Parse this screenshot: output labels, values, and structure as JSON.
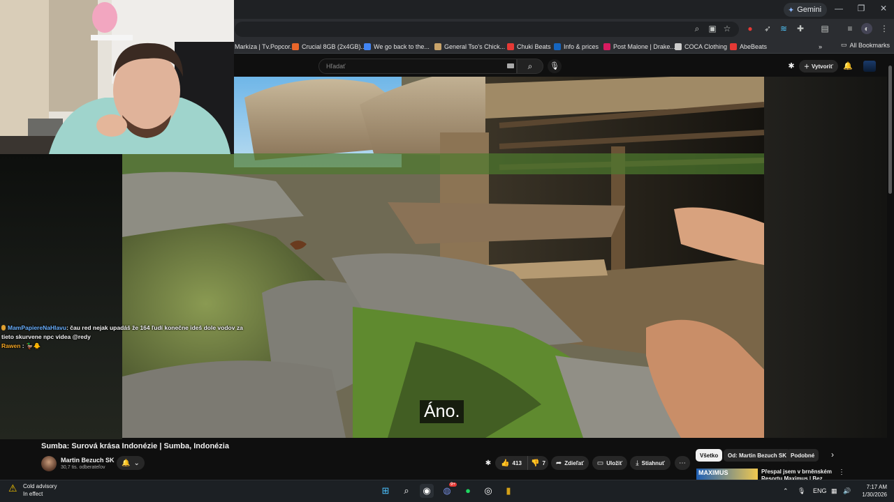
{
  "browser": {
    "gemini_label": "Gemini",
    "bookmarks": [
      {
        "label": "Markíza | Tv.Popcor...",
        "color": "#3c4fa0"
      },
      {
        "label": "Crucial 8GB (2x4GB)...",
        "color": "#e8662a"
      },
      {
        "label": "We go back to the...",
        "color": "#4285f4"
      },
      {
        "label": "General Tso's Chick...",
        "color": "#c9a46a"
      },
      {
        "label": "Chuki Beats",
        "color": "#e53935"
      },
      {
        "label": "Info & prices",
        "color": "#1565c0"
      },
      {
        "label": "Post Malone | Drake...",
        "color": "#d81b60"
      },
      {
        "label": "COCA Clothing",
        "color": "#cccccc"
      },
      {
        "label": "AbeBeats",
        "color": "#e53935"
      }
    ],
    "all_bookmarks_label": "All Bookmarks"
  },
  "youtube": {
    "search_placeholder": "Hľadať",
    "create_label": "Vytvoriť"
  },
  "video": {
    "caption": "Áno.",
    "title": "Sumba: Surová krása Indonézie | Sumba, Indonézia",
    "channel_name": "Martin Bezuch SK",
    "subscribers": "30,7 tis. odberateľov",
    "likes": "413",
    "dislikes": "7",
    "share_label": "Zdieľať",
    "save_label": "Uložiť",
    "download_label": "Stiahnuť"
  },
  "chips": [
    {
      "label": "Všetko",
      "active": true
    },
    {
      "label": "Od: Martin Bezuch SK",
      "active": false
    },
    {
      "label": "Podobné",
      "active": false
    }
  ],
  "recommendation": {
    "thumb_text": "MAXIMUS",
    "title": "Přespal jsem v brněnském Resortu Maximus | Bez placek"
  },
  "chat": [
    {
      "user": "MamPapiereNaHlavu",
      "message": "čau red nejak upadáš že 164 ľudí konečne ideš dole vodov za tieto skurvene npc videa @redy"
    },
    {
      "user": "Rawen",
      "message": "🦆🐥"
    }
  ],
  "taskbar": {
    "weather_title": "Cold advisory",
    "weather_subtitle": "In effect",
    "language": "ENG",
    "time": "7:17 AM",
    "date": "1/30/2026",
    "discord_badge": "9+"
  }
}
